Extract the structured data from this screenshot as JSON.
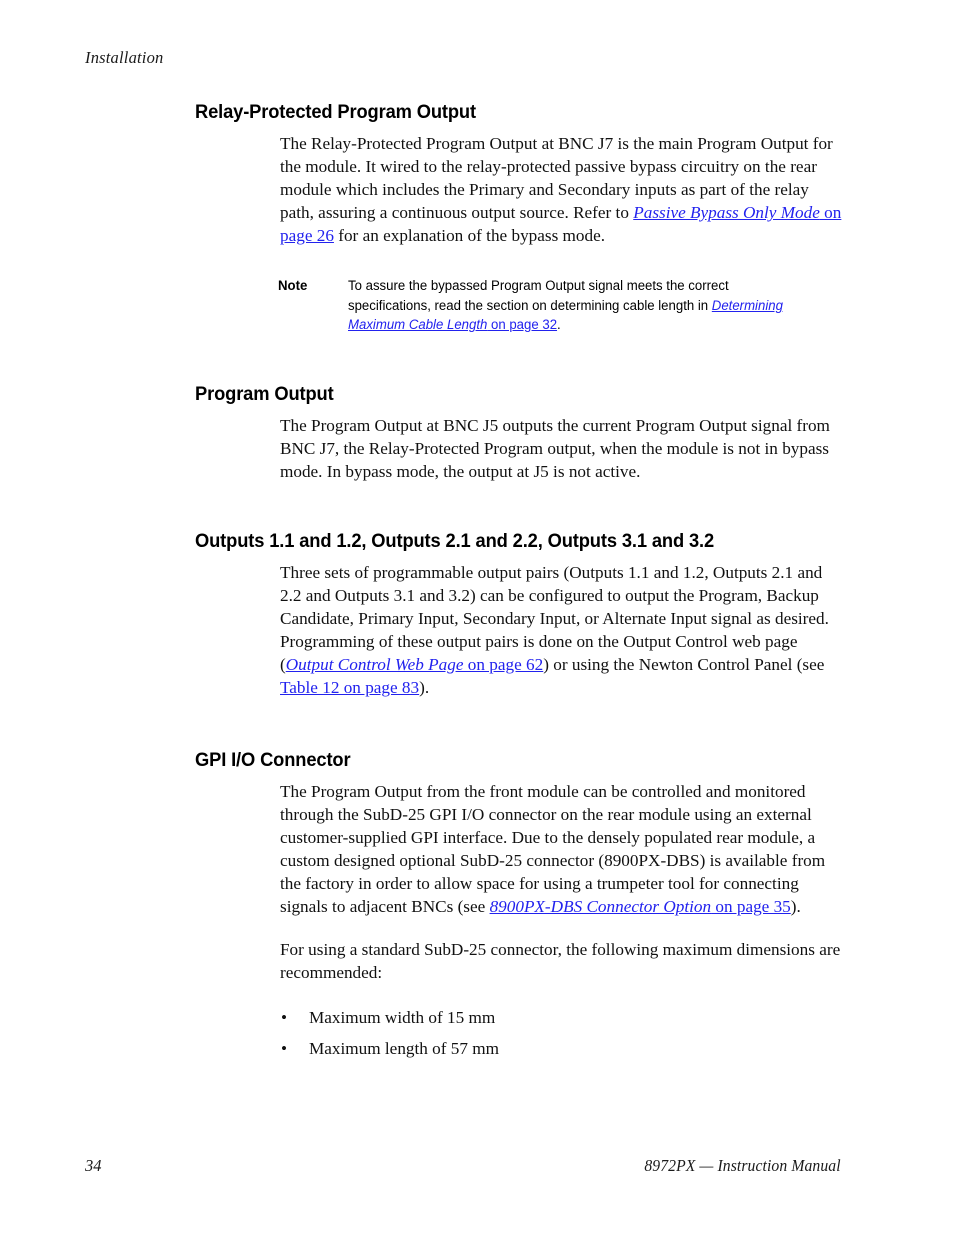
{
  "page": {
    "running_header": "Installation",
    "footer_page_number": "34",
    "footer_manual_title": "8972PX — Instruction Manual",
    "link_color": "#2222ee",
    "text_color": "#111111"
  },
  "sections": {
    "relay_protected": {
      "heading": "Relay-Protected Program Output",
      "paragraph_part1": "The Relay-Protected Program Output at BNC J7 is the main Program Output for the module. It wired to the relay-protected passive bypass circuitry on the rear module which includes the Primary and Secondary inputs as part of the relay path, assuring a continuous output source. Refer to ",
      "link_title": "Passive Bypass Only Mode",
      "link_page": " on page 26",
      "paragraph_part2": " for an explanation of the bypass mode."
    },
    "note": {
      "label": "Note",
      "text_part1": "To assure the bypassed Program Output signal meets the correct specifications, read the section on determining cable length in ",
      "link_title": "Determining Maximum Cable Length",
      "link_page": " on page 32",
      "text_part2": "."
    },
    "program_output": {
      "heading": "Program Output",
      "paragraph": "The Program Output at BNC J5 outputs the current Program Output signal from BNC J7, the Relay-Protected Program output, when the module is not in bypass mode. In bypass mode, the output at J5 is not active."
    },
    "outputs": {
      "heading": "Outputs 1.1 and 1.2, Outputs 2.1 and 2.2, Outputs 3.1 and 3.2",
      "paragraph_part1": "Three sets of programmable output pairs (Outputs 1.1 and 1.2, Outputs 2.1 and 2.2 and Outputs 3.1 and 3.2) can be configured to output the Program, Backup Candidate, Primary Input, Secondary Input, or Alternate Input signal as desired. Programming of these output pairs is done on the Output Control web page (",
      "link1_title": "Output Control Web Page",
      "link1_page": " on page 62",
      "paragraph_part2": ") or using the Newton Control Panel (see ",
      "link2_text": "Table 12 on page 83",
      "paragraph_part3": ")."
    },
    "gpi": {
      "heading": "GPI I/O Connector",
      "paragraph1_part1": "The Program Output from the front module can be controlled and monitored through the SubD-25 GPI I/O connector on the rear module using an external customer-supplied GPI interface. Due to the densely populated rear module, a custom designed optional SubD-25 connector (8900PX-DBS) is available from the factory in order to allow space for using a trumpeter tool for connecting signals to adjacent BNCs (see ",
      "link_title": "8900PX-DBS Connector Option",
      "link_page": " on page 35",
      "paragraph1_part2": ").",
      "paragraph2": "For using a standard SubD-25 connector, the following maximum dimensions are recommended:",
      "bullets": [
        {
          "marker": "•",
          "text": "Maximum width of 15 mm"
        },
        {
          "marker": "•",
          "text": "Maximum length of 57 mm"
        }
      ]
    }
  }
}
